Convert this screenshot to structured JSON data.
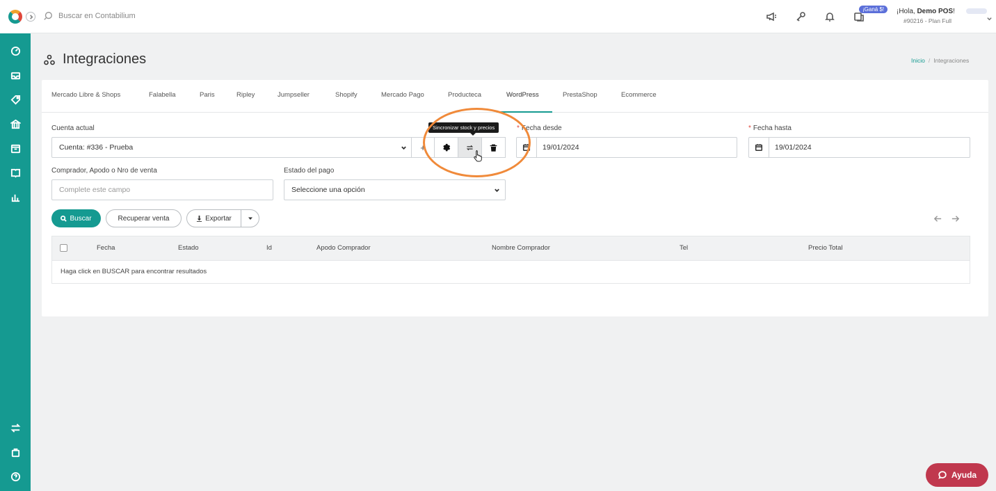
{
  "topbar": {
    "search_placeholder": "Buscar en Contabilium",
    "promo_badge": "¡Ganá $!",
    "greeting": "¡Hola, ",
    "user_name": "Demo POS",
    "greeting_end": "!",
    "plan": "#90216 - Plan Full"
  },
  "page": {
    "title": "Integraciones",
    "breadcrumb": [
      "Inicio",
      "Integraciones"
    ]
  },
  "tabs": [
    {
      "label": "Mercado Libre & Shops"
    },
    {
      "label": "Falabella"
    },
    {
      "label": "Paris"
    },
    {
      "label": "Ripley"
    },
    {
      "label": "Jumpseller"
    },
    {
      "label": "Shopify"
    },
    {
      "label": "Mercado Pago"
    },
    {
      "label": "Producteca"
    },
    {
      "label": "WordPress",
      "active": true
    },
    {
      "label": "PrestaShop"
    },
    {
      "label": "Ecommerce"
    }
  ],
  "form": {
    "account_label": "Cuenta actual",
    "account_value": "Cuenta: #336 - Prueba",
    "add_symbol": "+",
    "tooltip": "Sincronizar stock y precios",
    "date_from_label": "Fecha desde",
    "date_from_value": "19/01/2024",
    "date_to_label": "Fecha hasta",
    "date_to_value": "19/01/2024",
    "buyer_label": "Comprador, Apodo o Nro de venta",
    "buyer_placeholder": "Complete este campo",
    "payment_label": "Estado del pago",
    "payment_value": "Seleccione una opción",
    "required_mark": "*"
  },
  "actions": {
    "search": "Buscar",
    "recover": "Recuperar venta",
    "export": "Exportar"
  },
  "table": {
    "columns": [
      "Fecha",
      "Estado",
      "Id",
      "Apodo Comprador",
      "Nombre Comprador",
      "Tel",
      "Precio Total"
    ],
    "empty_message": "Haga click en BUSCAR para encontrar resultados"
  },
  "help": {
    "label": "Ayuda"
  },
  "colors": {
    "brand": "#159a91",
    "highlight": "#f08a3a",
    "help": "#c0384e"
  }
}
